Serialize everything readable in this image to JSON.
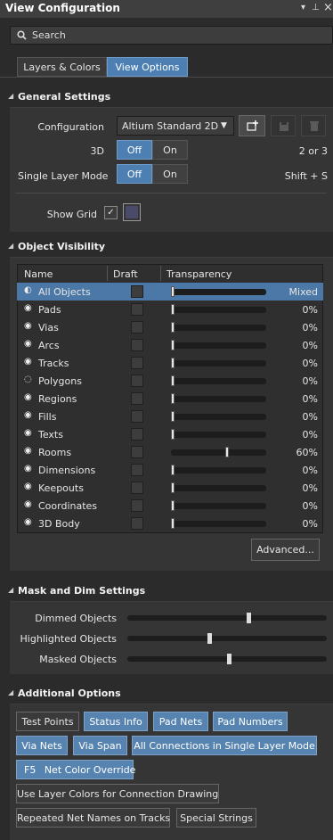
{
  "window": {
    "title": "View Configuration",
    "menu_icon": "▾",
    "pin_icon": "⊥",
    "close_icon": "×"
  },
  "search": {
    "placeholder": "Search"
  },
  "tabs": [
    {
      "label": "Layers & Colors",
      "active": false
    },
    {
      "label": "View Options",
      "active": true
    }
  ],
  "general": {
    "title": "General Settings",
    "configuration_label": "Configuration",
    "configuration_value": "Altium Standard 2D",
    "label_3d": "3D",
    "off": "Off",
    "on": "On",
    "hint_3d": "2 or 3",
    "single_layer_label": "Single Layer Mode",
    "hint_single": "Shift + S",
    "show_grid_label": "Show Grid"
  },
  "visibility": {
    "title": "Object Visibility",
    "headers": {
      "name": "Name",
      "draft": "Draft",
      "transparency": "Transparency"
    },
    "rows": [
      {
        "name": "All Objects",
        "value": "Mixed",
        "level": 0,
        "icon": "half-eye-icon",
        "selected": true
      },
      {
        "name": "Pads",
        "value": "0%",
        "level": 0,
        "icon": "eye-icon"
      },
      {
        "name": "Vias",
        "value": "0%",
        "level": 0,
        "icon": "eye-icon"
      },
      {
        "name": "Arcs",
        "value": "0%",
        "level": 0,
        "icon": "eye-icon"
      },
      {
        "name": "Tracks",
        "value": "0%",
        "level": 0,
        "icon": "eye-icon"
      },
      {
        "name": "Polygons",
        "value": "0%",
        "level": 0,
        "icon": "eye-hidden-icon"
      },
      {
        "name": "Regions",
        "value": "0%",
        "level": 0,
        "icon": "eye-icon"
      },
      {
        "name": "Fills",
        "value": "0%",
        "level": 0,
        "icon": "eye-icon"
      },
      {
        "name": "Texts",
        "value": "0%",
        "level": 0,
        "icon": "eye-icon"
      },
      {
        "name": "Rooms",
        "value": "60%",
        "level": 60,
        "icon": "eye-icon"
      },
      {
        "name": "Dimensions",
        "value": "0%",
        "level": 0,
        "icon": "eye-icon"
      },
      {
        "name": "Keepouts",
        "value": "0%",
        "level": 0,
        "icon": "eye-icon"
      },
      {
        "name": "Coordinates",
        "value": "0%",
        "level": 0,
        "icon": "eye-icon"
      },
      {
        "name": "3D Body",
        "value": "0%",
        "level": 0,
        "icon": "eye-icon"
      }
    ],
    "advanced": "Advanced..."
  },
  "mask": {
    "title": "Mask and Dim Settings",
    "dimmed": "Dimmed Objects",
    "dimmed_level": 0.6,
    "highlighted": "Highlighted Objects",
    "highlighted_level": 0.4,
    "masked": "Masked Objects",
    "masked_level": 0.5
  },
  "additional": {
    "title": "Additional Options",
    "test_points": "Test Points",
    "status_info": "Status Info",
    "pad_nets": "Pad Nets",
    "pad_numbers": "Pad Numbers",
    "via_nets": "Via Nets",
    "via_span": "Via Span",
    "all_connections": "All Connections in Single Layer Mode",
    "f5_key": "F5",
    "net_color_override": "Net Color Override",
    "use_layer_colors": "Use Layer Colors for Connection Drawing",
    "repeated_net_names": "Repeated Net Names on Tracks",
    "special_strings": "Special Strings"
  },
  "colors": {
    "accent": "#4d7fb3",
    "selected_row": "#4b78a6",
    "background": "#2b2b2b"
  }
}
